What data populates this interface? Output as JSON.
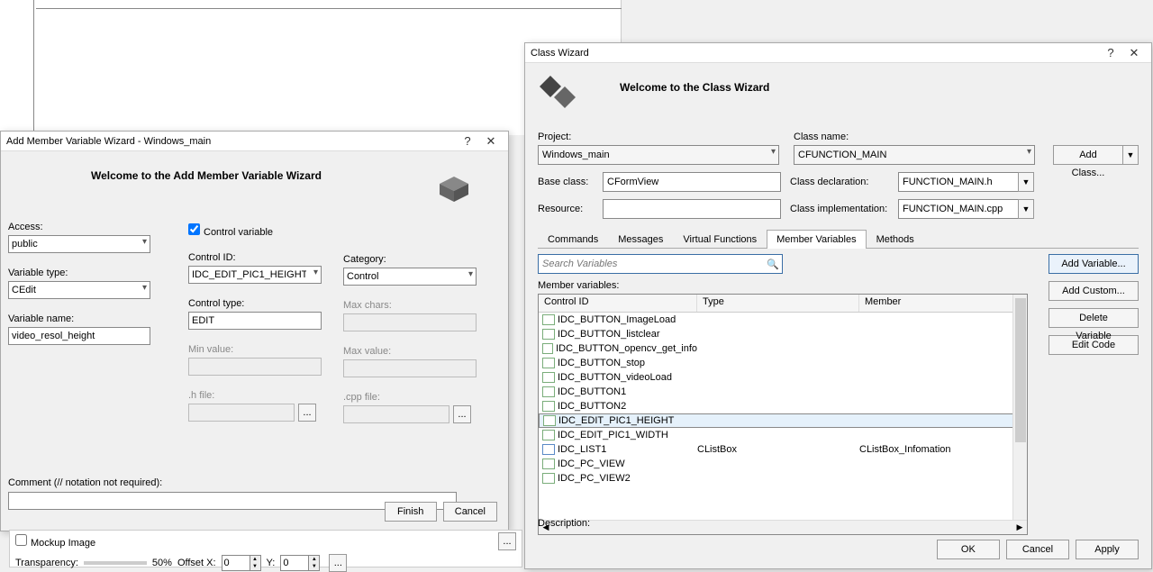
{
  "left_dialog": {
    "title": "Add Member Variable Wizard - Windows_main",
    "welcome": "Welcome to the Add Member Variable Wizard",
    "access_label": "Access:",
    "access_value": "public",
    "control_variable_label": "Control variable",
    "variable_type_label": "Variable type:",
    "variable_type_value": "CEdit",
    "variable_name_label": "Variable name:",
    "variable_name_value": "video_resol_height",
    "control_id_label": "Control ID:",
    "control_id_value": "IDC_EDIT_PIC1_HEIGHT",
    "control_type_label": "Control type:",
    "control_type_value": "EDIT",
    "min_value_label": "Min value:",
    "h_file_label": ".h file:",
    "category_label": "Category:",
    "category_value": "Control",
    "max_chars_label": "Max chars:",
    "max_value_label": "Max value:",
    "cpp_file_label": ".cpp file:",
    "comment_label": "Comment (// notation not required):",
    "finish": "Finish",
    "cancel": "Cancel"
  },
  "bottom": {
    "mockup_label": "Mockup Image",
    "transparency_label": "Transparency:",
    "transparency_value": "50%",
    "offsetx_label": "Offset X:",
    "offsetx_value": "0",
    "offsety_label": "Y:",
    "offsety_value": "0",
    "dots": "..."
  },
  "right_dialog": {
    "title": "Class Wizard",
    "welcome": "Welcome to the Class Wizard",
    "project_label": "Project:",
    "project_value": "Windows_main",
    "class_name_label": "Class name:",
    "class_name_value": "CFUNCTION_MAIN",
    "add_class": "Add Class...",
    "base_class_label": "Base class:",
    "base_class_value": "CFormView",
    "class_decl_label": "Class declaration:",
    "class_decl_value": "FUNCTION_MAIN.h",
    "resource_label": "Resource:",
    "class_impl_label": "Class implementation:",
    "class_impl_value": "FUNCTION_MAIN.cpp",
    "tabs": [
      "Commands",
      "Messages",
      "Virtual Functions",
      "Member Variables",
      "Methods"
    ],
    "search_placeholder": "Search Variables",
    "member_vars_label": "Member variables:",
    "grid_headers": [
      "Control ID",
      "Type",
      "Member"
    ],
    "rows": [
      {
        "id": "IDC_BUTTON_ImageLoad",
        "type": "",
        "member": ""
      },
      {
        "id": "IDC_BUTTON_listclear",
        "type": "",
        "member": ""
      },
      {
        "id": "IDC_BUTTON_opencv_get_info",
        "type": "",
        "member": ""
      },
      {
        "id": "IDC_BUTTON_stop",
        "type": "",
        "member": ""
      },
      {
        "id": "IDC_BUTTON_videoLoad",
        "type": "",
        "member": ""
      },
      {
        "id": "IDC_BUTTON1",
        "type": "",
        "member": ""
      },
      {
        "id": "IDC_BUTTON2",
        "type": "",
        "member": ""
      },
      {
        "id": "IDC_EDIT_PIC1_HEIGHT",
        "type": "",
        "member": "",
        "selected": true
      },
      {
        "id": "IDC_EDIT_PIC1_WIDTH",
        "type": "",
        "member": ""
      },
      {
        "id": "IDC_LIST1",
        "type": "CListBox",
        "member": "CListBox_Infomation",
        "blue": true
      },
      {
        "id": "IDC_PC_VIEW",
        "type": "",
        "member": ""
      },
      {
        "id": "IDC_PC_VIEW2",
        "type": "",
        "member": ""
      }
    ],
    "side_buttons": {
      "add_variable": "Add Variable...",
      "add_custom": "Add Custom...",
      "delete_variable": "Delete Variable",
      "edit_code": "Edit Code"
    },
    "description_label": "Description:",
    "ok": "OK",
    "cancel": "Cancel",
    "apply": "Apply"
  }
}
